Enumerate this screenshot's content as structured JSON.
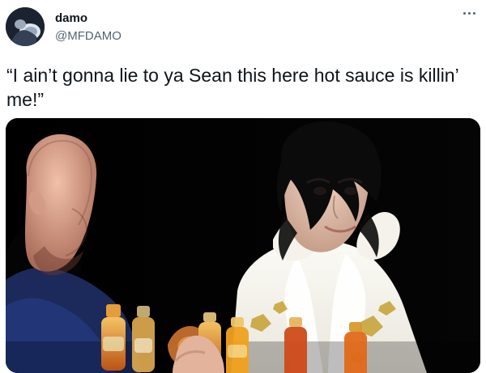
{
  "tweet": {
    "author": {
      "name": "damo",
      "handle": "@MFDAMO",
      "avatar_icon": "profile-avatar"
    },
    "more_icon": "more-horizontal-icon",
    "text": "“I ain’t gonna lie to ya Sean this here hot sauce is killin’ me!”",
    "media": {
      "type": "photo",
      "background": "#000000"
    }
  }
}
